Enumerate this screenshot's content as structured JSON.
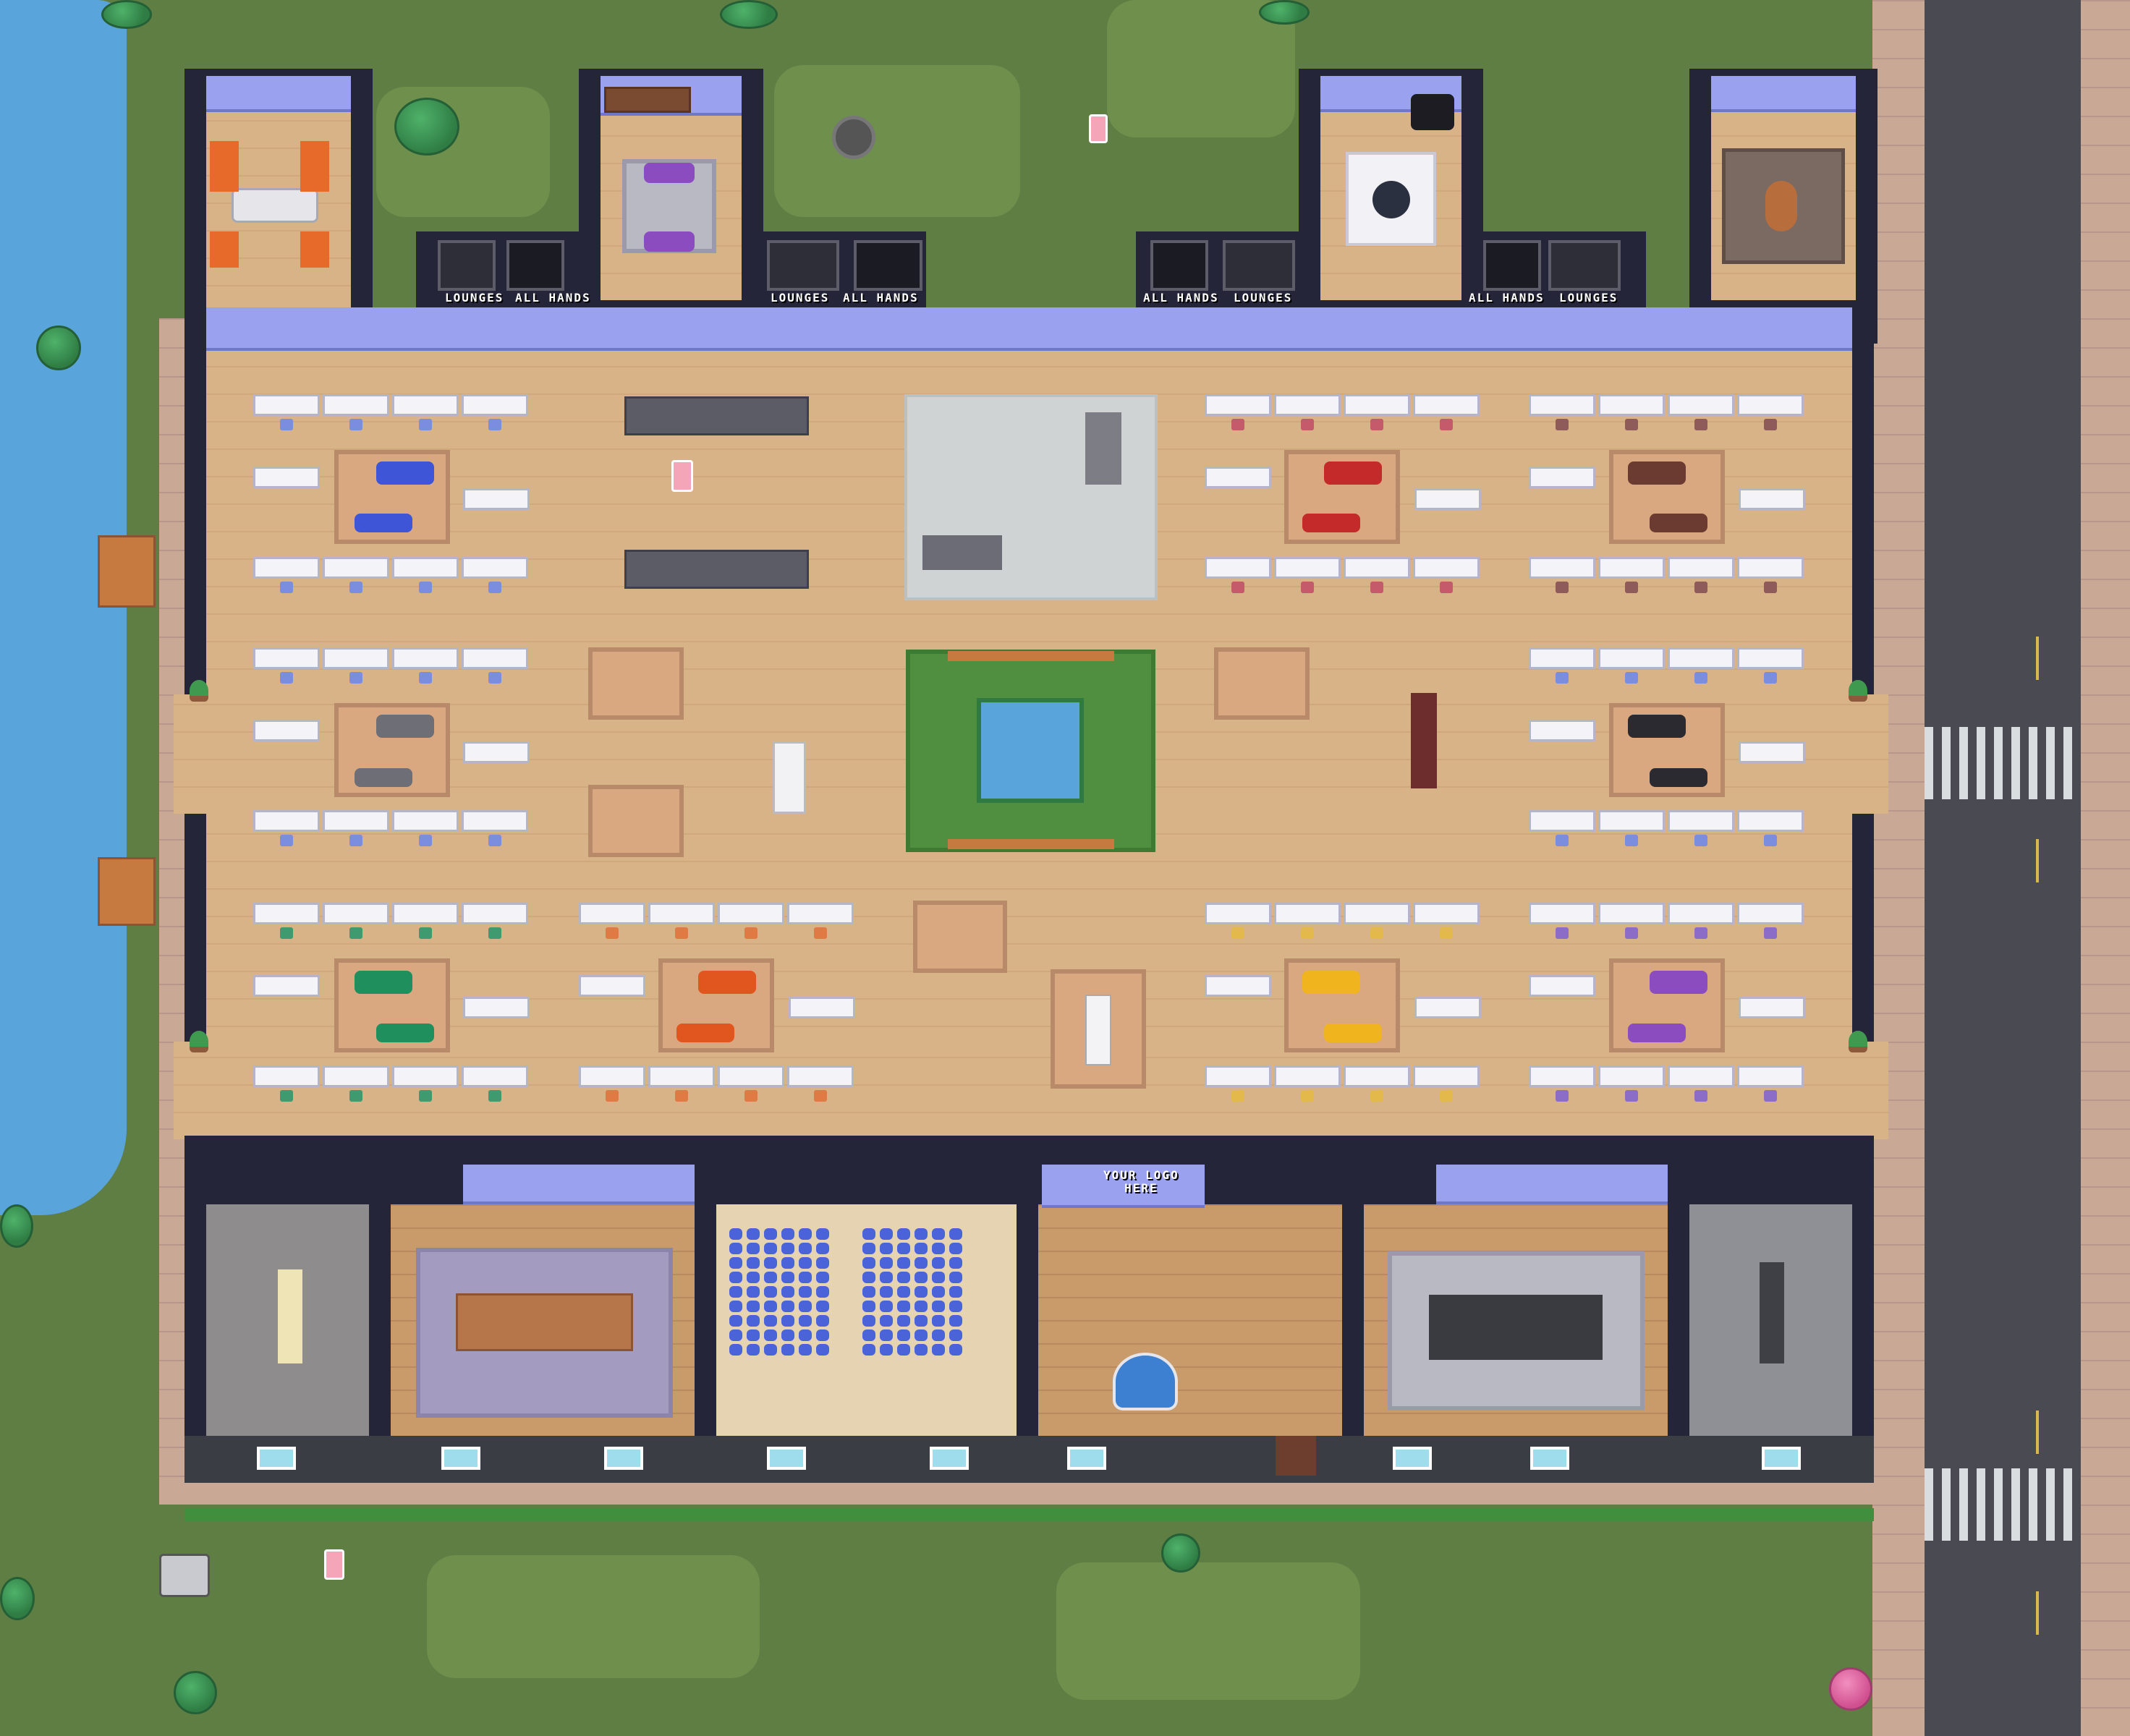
{
  "scene": "office-map",
  "signs": {
    "lounges": "LOUNGES",
    "all_hands": "ALL HANDS",
    "logo": "YOUR LOGO\nHERE"
  },
  "colors": {
    "grass": "#5f7e44",
    "water": "#5aa4dc",
    "floor": "#d8b387",
    "wall": "#25253a",
    "road": "#4a4b52",
    "accent_blue_wall": "#9aa2f0"
  },
  "icons": {
    "parking": "parking-sign-icon",
    "tree": "tree-icon",
    "plant": "potted-plant-icon"
  }
}
